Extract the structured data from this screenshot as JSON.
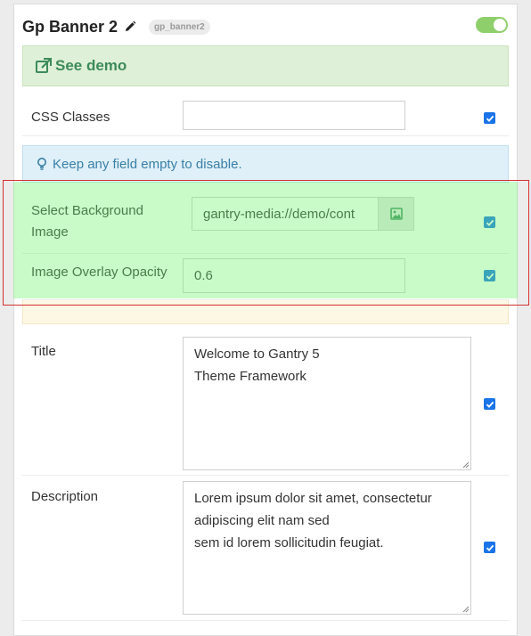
{
  "header": {
    "title": "Gp Banner 2",
    "tag": "gp_banner2",
    "enabled": true
  },
  "demo": {
    "label": "See demo"
  },
  "info": {
    "text": "Keep any field empty to disable."
  },
  "fields": {
    "css_classes": {
      "label": "CSS Classes",
      "value": "",
      "checked": true
    },
    "background_image": {
      "label_line1": "Select Background",
      "label_line2": "Image",
      "value": "gantry-media://demo/cont",
      "checked": true
    },
    "overlay_opacity": {
      "label": "Image Overlay Opacity",
      "value": "0.6",
      "checked": true
    },
    "title": {
      "label": "Title",
      "lines": [
        "Welcome to Gantry 5",
        "Theme Framework"
      ],
      "checked": true
    },
    "description": {
      "label": "Description",
      "lines": [
        "Lorem ipsum dolor sit amet, consectetur",
        "adipiscing elit nam sed",
        "sem id lorem sollicitudin feugiat."
      ],
      "checked": true
    }
  },
  "icons": {
    "edit": "pencil-icon",
    "external": "external-link-icon",
    "tip": "lightbulb-icon",
    "media": "image-icon",
    "check": "checkbox-checked-icon"
  },
  "colors": {
    "accent": "#1a73e8",
    "success": "#3c8b5a",
    "info": "#3a7fa8",
    "toggle_on": "#8fcf6b"
  }
}
